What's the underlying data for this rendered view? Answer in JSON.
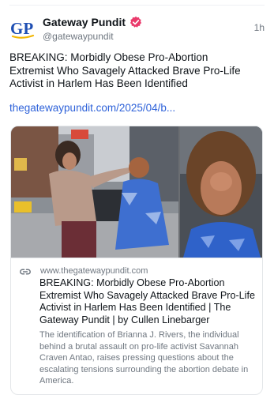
{
  "post": {
    "author": {
      "name": "Gateway Pundit",
      "handle": "@gatewaypundit",
      "avatar_text": "GP",
      "verified": true
    },
    "timestamp": "1h",
    "text": "BREAKING: Morbidly Obese Pro-Abortion Extremist Who Savagely Attacked Brave Pro-Life Activist in Harlem Has Been Identified",
    "link_text": "thegatewaypundit.com/2025/04/b..."
  },
  "card": {
    "domain": "www.thegatewaypundit.com",
    "title": "BREAKING: Morbidly Obese Pro-Abortion Extremist Who Savagely Attacked Brave Pro-Life Activist in Harlem Has Been Identified | The Gateway Pundit | by Cullen Linebarger",
    "description": "The identification of Brianna J. Rivers, the individual behind a brutal assault on pro-life activist Savannah Craven Antao, raises pressing questions about the escalating tensions surrounding the abortion debate in America."
  },
  "colors": {
    "link": "#2e62d9",
    "avatar_blue": "#1f4fb3",
    "avatar_yellow": "#f2b705",
    "verified_badge": "#ea3a6b",
    "muted_text": "#6f7780",
    "border": "#e3e6e9"
  },
  "icons": {
    "verified": "verified-badge-icon",
    "link": "link-icon"
  }
}
